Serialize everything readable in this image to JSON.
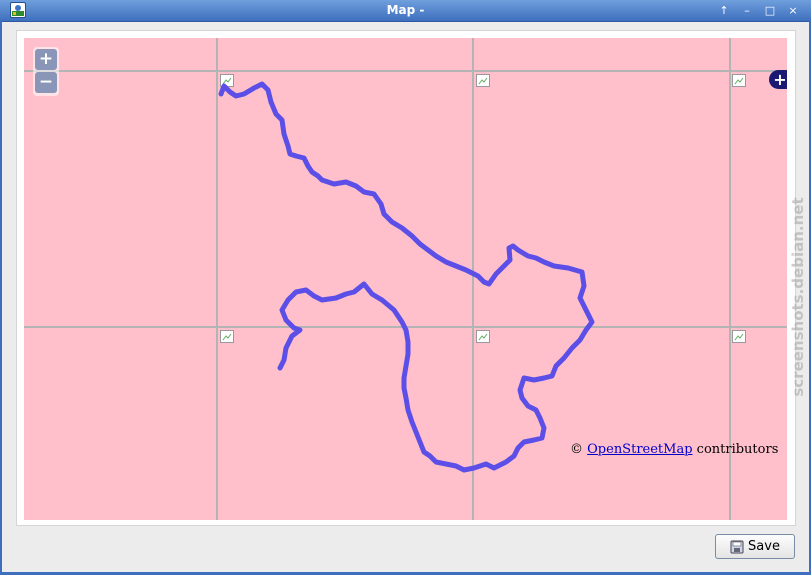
{
  "window": {
    "title": "Map -",
    "buttons": {
      "restore": "↑",
      "minimize": "–",
      "maximize": "□",
      "close": "×"
    }
  },
  "map": {
    "background": "#ffc0cb",
    "grid_color": "#b0b0b0",
    "track_color": "#5b4fe8",
    "zoom_in_label": "+",
    "zoom_out_label": "−",
    "layer_switcher_label": "+",
    "attribution": {
      "prefix": "© ",
      "link_text": "OpenStreetMap",
      "suffix": " contributors"
    }
  },
  "watermark": "screenshots.debian.net",
  "footer": {
    "save_label": "Save",
    "save_icon": "save-icon"
  }
}
